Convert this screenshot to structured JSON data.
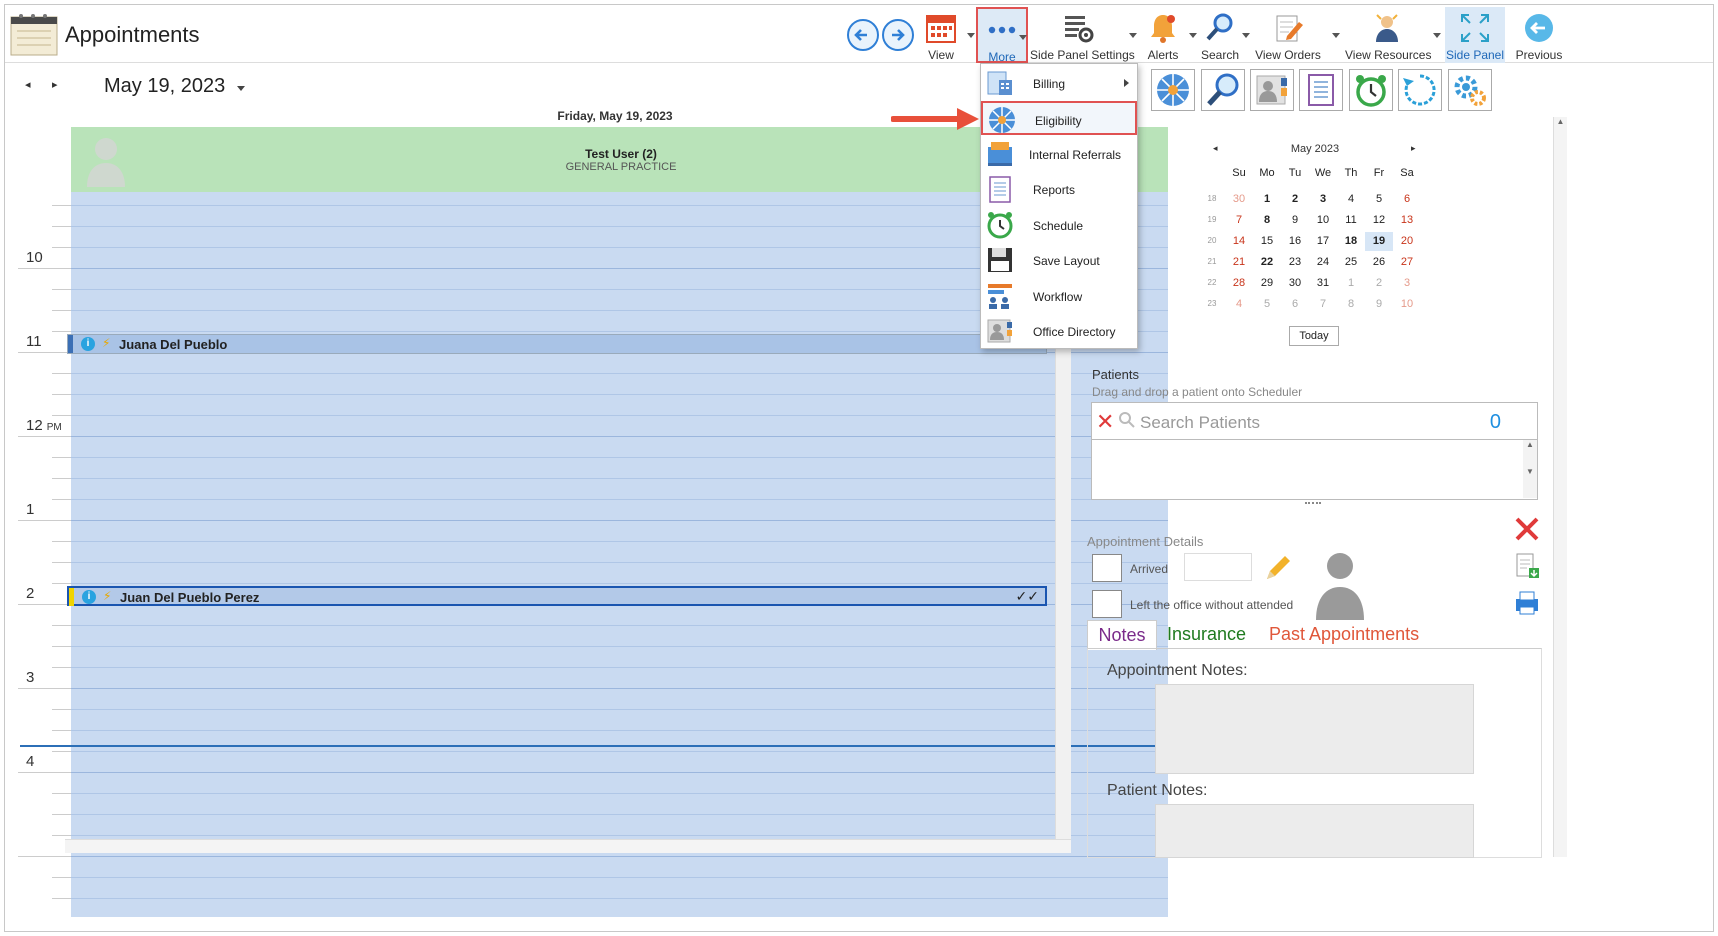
{
  "header": {
    "title": "Appointments",
    "toolbar": {
      "view": "View",
      "more": "More",
      "side_panel_settings": "Side Panel Settings",
      "alerts": "Alerts",
      "search": "Search",
      "view_orders": "View Orders",
      "view_resources": "View Resources",
      "side_panel": "Side Panel",
      "previous": "Previous"
    }
  },
  "date_nav": {
    "prev": "◂",
    "next": "▸",
    "date": "May 19, 2023",
    "day_header": "Friday, May 19, 2023"
  },
  "resource": {
    "name": "Test User (2)",
    "specialty": "GENERAL PRACTICE"
  },
  "hours": [
    {
      "label": "10",
      "suffix": ""
    },
    {
      "label": "11",
      "suffix": ""
    },
    {
      "label": "12",
      "suffix": "PM"
    },
    {
      "label": "1",
      "suffix": ""
    },
    {
      "label": "2",
      "suffix": ""
    },
    {
      "label": "3",
      "suffix": ""
    },
    {
      "label": "4",
      "suffix": ""
    }
  ],
  "appointments": [
    {
      "patient": "Juana Del Pueblo",
      "info": "i"
    },
    {
      "patient": "Juan Del Pueblo Perez",
      "info": "i",
      "status": "✓✓"
    }
  ],
  "more_menu": {
    "items": [
      {
        "label": "Billing",
        "has_submenu": true
      },
      {
        "label": "Eligibility",
        "highlighted": true
      },
      {
        "label": "Internal Referrals"
      },
      {
        "label": "Reports"
      },
      {
        "label": "Schedule"
      },
      {
        "label": "Save Layout"
      },
      {
        "label": "Workflow"
      },
      {
        "label": "Office Directory"
      }
    ]
  },
  "mini_calendar": {
    "title": "May 2023",
    "prev": "◂",
    "next": "▸",
    "weekdays": [
      "Su",
      "Mo",
      "Tu",
      "We",
      "Th",
      "Fr",
      "Sa"
    ],
    "weeks": [
      {
        "wk": "18",
        "days": [
          "30",
          "1",
          "2",
          "3",
          "4",
          "5",
          "6"
        ]
      },
      {
        "wk": "19",
        "days": [
          "7",
          "8",
          "9",
          "10",
          "11",
          "12",
          "13"
        ]
      },
      {
        "wk": "20",
        "days": [
          "14",
          "15",
          "16",
          "17",
          "18",
          "19",
          "20"
        ]
      },
      {
        "wk": "21",
        "days": [
          "21",
          "22",
          "23",
          "24",
          "25",
          "26",
          "27"
        ]
      },
      {
        "wk": "22",
        "days": [
          "28",
          "29",
          "30",
          "31",
          "1",
          "2",
          "3"
        ]
      },
      {
        "wk": "23",
        "days": [
          "4",
          "5",
          "6",
          "7",
          "8",
          "9",
          "10"
        ]
      }
    ],
    "today_button": "Today"
  },
  "patients": {
    "title": "Patients",
    "hint": "Drag and drop a patient onto Scheduler",
    "search_placeholder": "Search Patients",
    "count": "0"
  },
  "appointment_details": {
    "title": "Appointment Details",
    "arrived": "Arrived",
    "left_office": "Left the office without attended"
  },
  "tabs": {
    "notes": "Notes",
    "insurance": "Insurance",
    "past": "Past Appointments"
  },
  "notes": {
    "appointment_notes": "Appointment Notes:",
    "patient_notes": "Patient Notes:"
  },
  "colors": {
    "accent": "#2f7fd6",
    "highlight": "#e05252",
    "resource_header": "#b9e3b9",
    "grid": "#c9daf1",
    "tab_notes": "#7a2a8a",
    "tab_insurance": "#1f7a1f",
    "tab_past": "#e0573a"
  }
}
